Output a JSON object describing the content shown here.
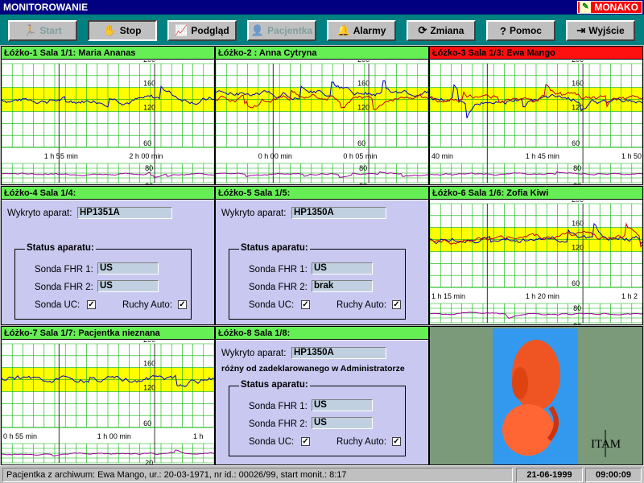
{
  "window": {
    "title": "MONITOROWANIE",
    "brand": "MONAKO"
  },
  "toolbar": [
    {
      "key": "start",
      "label": "Start",
      "icon": "runner-icon",
      "disabled": true,
      "pressed": false
    },
    {
      "key": "stop",
      "label": "Stop",
      "icon": "hand-stop-icon",
      "disabled": false,
      "pressed": true
    },
    {
      "key": "podglad",
      "label": "Podgląd",
      "icon": "chart-preview-icon",
      "disabled": false,
      "pressed": false
    },
    {
      "key": "pacjentka",
      "label": "Pacjentka",
      "icon": "patient-icon",
      "disabled": true,
      "pressed": false
    },
    {
      "key": "alarmy",
      "label": "Alarmy",
      "icon": "alarm-icon",
      "disabled": false,
      "pressed": false
    },
    {
      "key": "zmiana",
      "label": "Zmiana",
      "icon": "swap-icon",
      "disabled": false,
      "pressed": false
    },
    {
      "key": "pomoc",
      "label": "Pomoc",
      "icon": "help-icon",
      "disabled": false,
      "pressed": false
    },
    {
      "key": "wyjscie",
      "label": "Wyjście",
      "icon": "exit-icon",
      "disabled": false,
      "pressed": false
    }
  ],
  "beds": [
    {
      "title": "Łóżko-1 Sala 1/1: Maria Ananas",
      "alarm": false,
      "type": "chart",
      "times": [
        "1 h 55 min",
        "2 h 00 min"
      ],
      "fhr_labels": [
        "200",
        "160",
        "120",
        "60"
      ],
      "uc_labels": [
        "80",
        "20"
      ]
    },
    {
      "title": "Łóżko-2 : Anna Cytryna",
      "alarm": false,
      "type": "chart",
      "times": [
        "0 h 00 min",
        "0 h 05 min"
      ],
      "fhr_labels": [
        "200",
        "160",
        "120",
        "60"
      ],
      "uc_labels": [
        "80",
        "20"
      ]
    },
    {
      "title": "Łóżko-3 Sala 1/3: Ewa Mango",
      "alarm": true,
      "type": "chart",
      "times": [
        "40 min",
        "1 h 45 min",
        "1 h 50 mi"
      ],
      "fhr_labels": [
        "200",
        "160",
        "120",
        "60"
      ],
      "uc_labels": [
        "80",
        "20"
      ]
    },
    {
      "title": "Łóżko-4 Sala 1/4:",
      "alarm": false,
      "type": "form",
      "detected_label": "Wykryto aparat:",
      "device": "HP1351A",
      "status_title": "Status aparatu:",
      "fhr1_label": "Sonda FHR 1:",
      "fhr1": "US",
      "fhr2_label": "Sonda FHR 2:",
      "fhr2": "US",
      "uc_label": "Sonda UC:",
      "uc_checked": true,
      "auto_label": "Ruchy Auto:",
      "auto_checked": true
    },
    {
      "title": "Łóżko-5 Sala 1/5:",
      "alarm": false,
      "type": "form",
      "detected_label": "Wykryto aparat:",
      "device": "HP1350A",
      "status_title": "Status aparatu:",
      "fhr1_label": "Sonda FHR 1:",
      "fhr1": "US",
      "fhr2_label": "Sonda FHR 2:",
      "fhr2": "brak",
      "uc_label": "Sonda UC:",
      "uc_checked": true,
      "auto_label": "Ruchy Auto:",
      "auto_checked": true
    },
    {
      "title": "Łóżko-6 Sala 1/6: Zofia Kiwi",
      "alarm": false,
      "type": "chart",
      "times": [
        "1 h 15 min",
        "1 h 20 min",
        "1 h 2"
      ],
      "fhr_labels": [
        "200",
        "160",
        "120",
        "60"
      ],
      "uc_labels": [
        "80",
        "20"
      ]
    },
    {
      "title": "Łóżko-7 Sala 1/7: Pacjentka nieznana",
      "alarm": false,
      "type": "chart",
      "times": [
        "0 h 55 min",
        "1 h 00 min",
        "1 h"
      ],
      "fhr_labels": [
        "200",
        "160",
        "120",
        "60"
      ],
      "uc_labels": [
        "20"
      ]
    },
    {
      "title": "Łóżko-8 Sala 1/8:",
      "alarm": false,
      "type": "form",
      "detected_label": "Wykryto aparat:",
      "device": "HP1350A",
      "note": "różny od zadeklarowanego w Administratorze",
      "status_title": "Status aparatu:",
      "fhr1_label": "Sonda FHR 1:",
      "fhr1": "US",
      "fhr2_label": "Sonda FHR 2:",
      "fhr2": "US",
      "uc_label": "Sonda UC:",
      "uc_checked": true,
      "auto_label": "Ruchy Auto:",
      "auto_checked": true
    }
  ],
  "logo": {
    "text": "ITAM"
  },
  "statusbar": {
    "info": "Pacjentka z archiwum: Ewa Mango, ur.: 20-03-1971, nr id.: 00026/99, start monit.: 8:17",
    "date": "21-06-1999",
    "time": "09:00:09"
  },
  "colors": {
    "normal_header": "#66ee55",
    "alarm_header": "#ff1010",
    "normal_band": "#ffff00",
    "trace1": "#0000c0",
    "trace2": "#c00000",
    "uc_trace": "#a000a0",
    "grid": "#00b000"
  }
}
